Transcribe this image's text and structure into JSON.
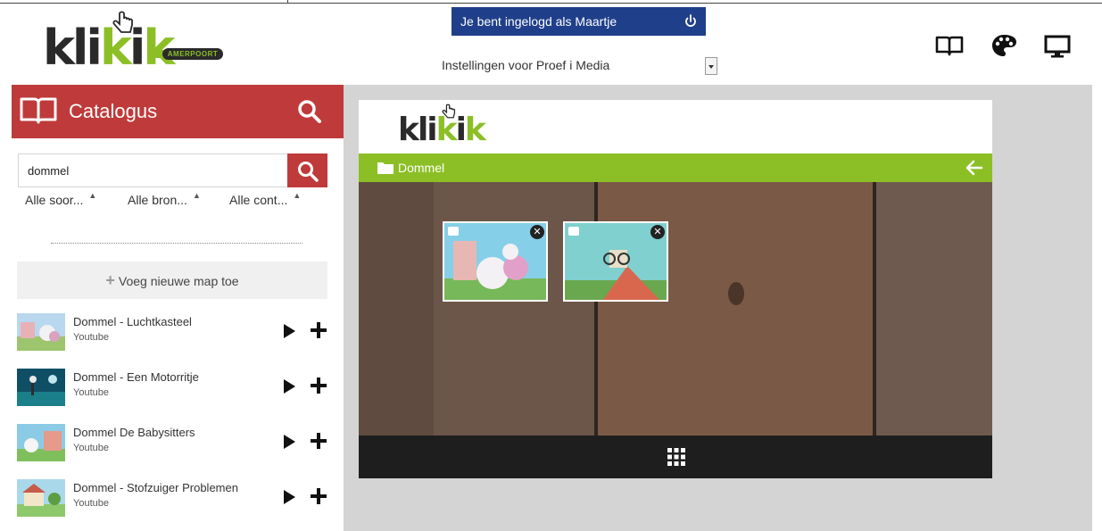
{
  "header": {
    "logo_text_dark": "kli",
    "logo_text_green_1": "k",
    "logo_text_dark_2": "i",
    "logo_text_green_2": "k",
    "logo_badge": "AMERPOORT",
    "login_text": "Je bent ingelogd als Maartje",
    "settings_label": "Instellingen voor  Proef i Media",
    "icons": [
      "book-icon",
      "palette-icon",
      "monitor-icon"
    ]
  },
  "catalog": {
    "title": "Catalogus",
    "search_value": "dommel",
    "filters": [
      "Alle soor...",
      "Alle bron...",
      "Alle cont..."
    ],
    "add_folder_label": "Voeg nieuwe map toe",
    "items": [
      {
        "title": "Dommel - Luchtkasteel",
        "source": "Youtube"
      },
      {
        "title": "Dommel - Een Motorritje",
        "source": "Youtube"
      },
      {
        "title": "Dommel De Babysitters",
        "source": "Youtube"
      },
      {
        "title": "Dommel - Stofzuiger Problemen",
        "source": "Youtube"
      }
    ]
  },
  "board": {
    "logo_dark": "kli",
    "logo_green": "k",
    "logo_dark_2": "i",
    "logo_green_2": "k",
    "folder_label": "Dommel",
    "tile_close_glyph": "✕"
  },
  "colors": {
    "catalog_red": "#bf3a3a",
    "login_blue": "#1f3f8a",
    "accent_green": "#8cbf26"
  }
}
